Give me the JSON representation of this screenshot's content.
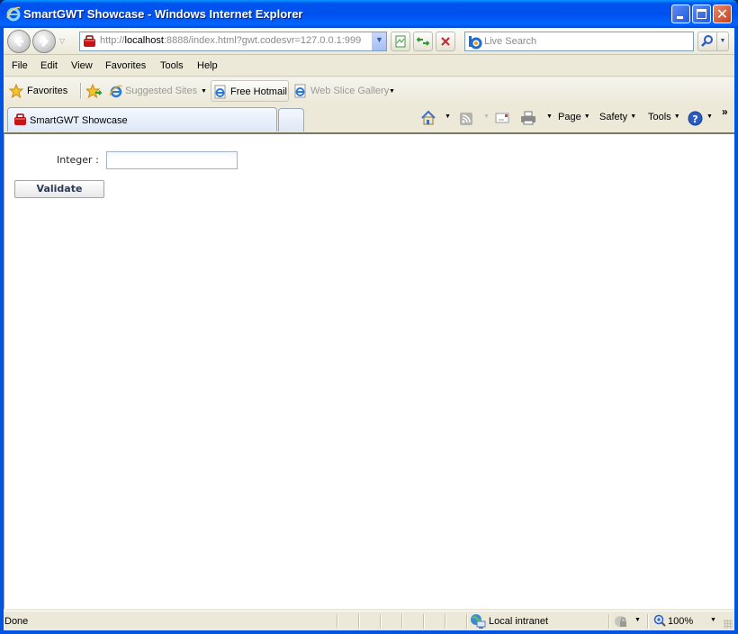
{
  "window": {
    "title": "SmartGWT Showcase - Windows Internet Explorer",
    "controls": {
      "minimize": "minimize",
      "maximize": "maximize",
      "close": "close"
    }
  },
  "address_bar": {
    "url_prefix": "http://",
    "url_host": "localhost",
    "url_rest": ":8888/index.html?gwt.codesvr=127.0.0.1:999",
    "search_placeholder": "Live Search"
  },
  "menu": {
    "items": [
      "File",
      "Edit",
      "View",
      "Favorites",
      "Tools",
      "Help"
    ]
  },
  "favorites_bar": {
    "favorites_label": "Favorites",
    "links": [
      {
        "label": "Suggested Sites",
        "has_dropdown": true,
        "dimmed": true
      },
      {
        "label": "Free Hotmail",
        "has_dropdown": false,
        "dimmed": false
      },
      {
        "label": "Web Slice Gallery",
        "has_dropdown": true,
        "dimmed": true
      }
    ]
  },
  "tabs": {
    "active_tab": "SmartGWT Showcase"
  },
  "command_bar": {
    "page": "Page",
    "safety": "Safety",
    "tools": "Tools",
    "overflow": "»"
  },
  "page": {
    "form": {
      "integer_label": "Integer :",
      "integer_value": "",
      "validate_button": "Validate"
    }
  },
  "status_bar": {
    "status": "Done",
    "zone": "Local intranet",
    "zoom": "100%"
  },
  "colors": {
    "titlebar_blue": "#0054e3",
    "chrome": "#ece9d8",
    "close_red": "#c3401c"
  }
}
